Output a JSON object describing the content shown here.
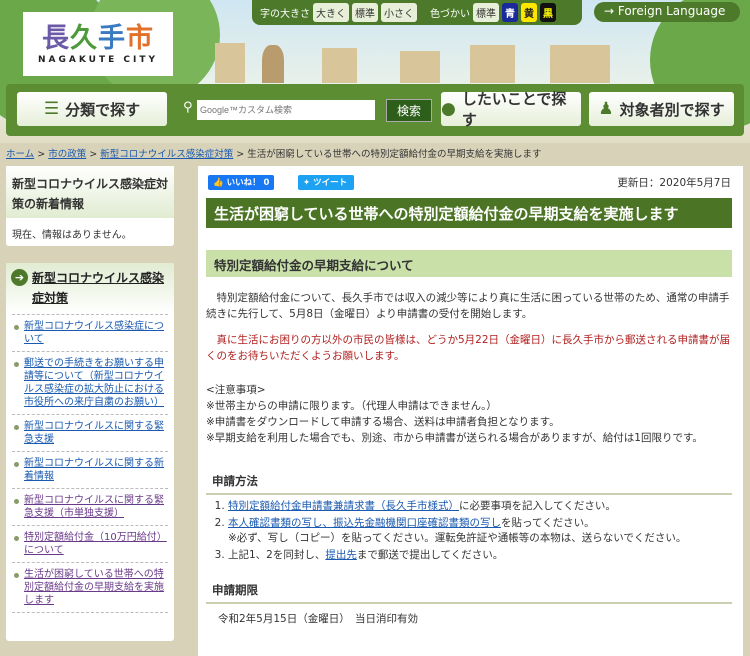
{
  "header": {
    "logo_jp": "長久手市",
    "logo_en": "NAGAKUTE CITY",
    "font_size_label": "字の大きさ",
    "font_sizes": [
      "大きく",
      "標準",
      "小さく"
    ],
    "color_label": "色づかい",
    "colors": [
      "標準",
      "青",
      "黄",
      "黒"
    ],
    "foreign_language": "→ Foreign Language",
    "nav": {
      "category": "分類で探す",
      "want": "したいことで探す",
      "target": "対象者別で探す"
    },
    "search_placeholder": "Google™カスタム検索",
    "search_button": "検索"
  },
  "breadcrumb": [
    "ホーム",
    "市の政策",
    "新型コロナウイルス感染症対策",
    "生活が困窮している世帯への特別定額給付金の早期支給を実施します"
  ],
  "sidebar": {
    "news_title": "新型コロナウイルス感染症対策の新着情報",
    "news_empty": "現在、情報はありません。",
    "menu_title": "新型コロナウイルス感染症対策",
    "items": [
      "新型コロナウイルス感染症について",
      "郵送での手続きをお願いする申請等について（新型コロナウイルス感染症の拡大防止における市役所への来庁自粛のお願い）",
      "新型コロナウイルスに関する緊急支援",
      "新型コロナウイルスに関する新着情報",
      "新型コロナウイルスに関する緊急支援（市単独支援）",
      "特別定額給付金（10万円給付）について",
      "生活が困窮している世帯への特別定額給付金の早期支給を実施します"
    ]
  },
  "main": {
    "like": "いいね！ 0",
    "tweet": "ツイート",
    "updated": "更新日：2020年5月7日",
    "title": "生活が困窮している世帯への特別定額給付金の早期支給を実施します",
    "subtitle": "特別定額給付金の早期支給について",
    "para1": "　特別定額給付金について、長久手市では収入の減少等により真に生活に困っている世帯のため、通常の申請手続きに先行して、5月8日（金曜日）より申請書の受付を開始します。",
    "para2": "　真に生活にお困りの方以外の市民の皆様は、どうか5月22日（金曜日）に長久手市から郵送される申請書が届くのをお待ちいただくようお願いします。",
    "notes": [
      "<注意事項>",
      "※世帯主からの申請に限ります。（代理人申請はできません。）",
      "※申請書をダウンロードして申請する場合、送料は申請者負担となります。",
      "※早期支給を利用した場合でも、別途、市から申請書が送られる場合がありますが、給付は1回限りです。"
    ],
    "method_title": "申請方法",
    "method": [
      {
        "link": "特別定額給付金申請書兼請求書（長久手市様式）",
        "text": "に必要事項を記入してください。"
      },
      {
        "link": "本人確認書類の写し、振込先金融機関口座確認書類の写し",
        "text": "を貼ってください。",
        "note": "※必ず、写し（コピー）を貼ってください。運転免許証や通帳等の本物は、送らないでください。"
      },
      {
        "pre": "上記1、2を同封し、",
        "link": "提出先",
        "text": "まで郵送で提出してください。"
      }
    ],
    "deadline_title": "申請期限",
    "deadline": "令和2年5月15日（金曜日）　当日消印有効"
  }
}
